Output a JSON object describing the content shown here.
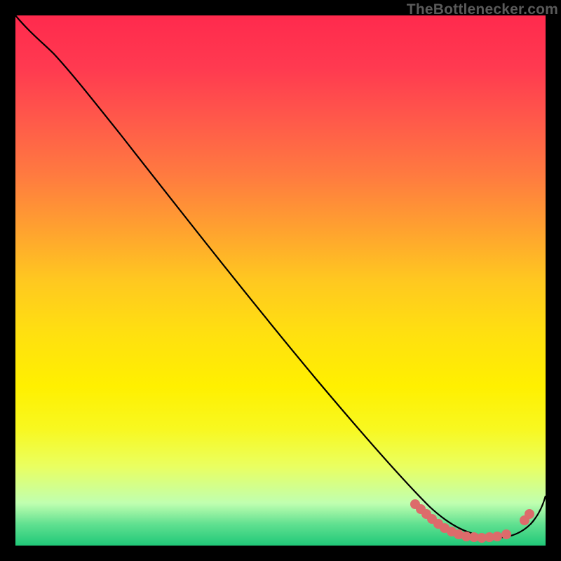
{
  "branding": {
    "text": "TheBottlenecker.com"
  },
  "chart_data": {
    "type": "line",
    "title": "",
    "xlabel": "",
    "ylabel": "",
    "xlim": [
      0,
      100
    ],
    "ylim": [
      0,
      100
    ],
    "x": [
      0,
      4,
      8,
      12,
      16,
      20,
      24,
      28,
      32,
      36,
      40,
      44,
      48,
      52,
      56,
      60,
      64,
      68,
      72,
      76,
      80,
      84,
      88,
      92,
      96,
      100
    ],
    "y": [
      100,
      98,
      95,
      91,
      86,
      81,
      75,
      69,
      63,
      57,
      51,
      45,
      39,
      33,
      27,
      22,
      17,
      13,
      9,
      6,
      3.5,
      2,
      1.5,
      2,
      5,
      10
    ],
    "marker_points": {
      "x": [
        75,
        76,
        77,
        78,
        80,
        82,
        84,
        86,
        88,
        90,
        96,
        97
      ],
      "y": [
        6,
        5.2,
        4.5,
        4,
        3.2,
        2.5,
        2.1,
        1.8,
        1.7,
        1.8,
        5,
        5.8
      ]
    },
    "colors": {
      "curve": "#000000",
      "markers": "#dd6b6b",
      "background_top": "#ff2a4d",
      "background_bottom": "#20c878"
    }
  }
}
